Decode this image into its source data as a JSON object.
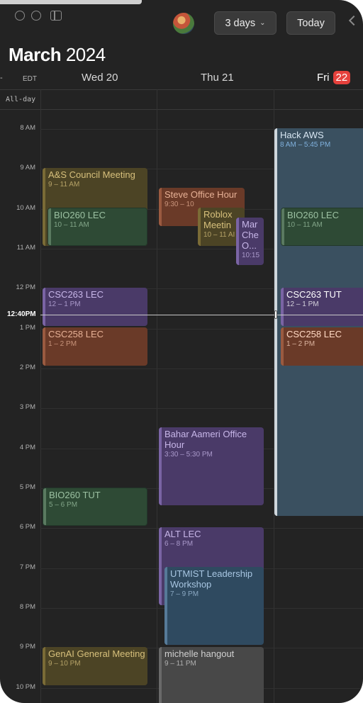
{
  "toolbar": {
    "view_label": "3 days",
    "today_label": "Today"
  },
  "header": {
    "month": "March",
    "year": "2024",
    "timezone": "EDT",
    "days": [
      {
        "label": "Wed 20"
      },
      {
        "label": "Thu 21"
      },
      {
        "label": "Fri",
        "date": "22",
        "is_today": true
      }
    ]
  },
  "all_day_label": "All-day",
  "hours": [
    "8 AM",
    "9 AM",
    "10 AM",
    "11 AM",
    "12 PM",
    "1 PM",
    "2 PM",
    "3 PM",
    "4 PM",
    "5 PM",
    "6 PM",
    "7 PM",
    "8 PM",
    "9 PM",
    "10 PM"
  ],
  "current_time": "12:40PM",
  "events": {
    "wed": [
      {
        "title": "A&S Council Meeting",
        "time": "9 – 11 AM",
        "color": "#4c4425"
      },
      {
        "title": "BIO260 LEC",
        "time": "10 – 11 AM",
        "color": "#2e4a35"
      },
      {
        "title": "CSC263 LEC",
        "time": "12 – 1 PM",
        "color": "#4a3a68"
      },
      {
        "title": "CSC258 LEC",
        "time": "1 – 2 PM",
        "color": "#6a3a28"
      },
      {
        "title": "BIO260 TUT",
        "time": "5 – 6 PM",
        "color": "#2e4a35"
      },
      {
        "title": "GenAI General Meeting",
        "time": "9 – 10 PM",
        "color": "#4c4425"
      }
    ],
    "thu": [
      {
        "title": "Steve Office Hour",
        "time": "9:30 – 10",
        "color": "#6a3a28"
      },
      {
        "title": "Roblox Meetin",
        "time": "10 – 11 AI",
        "color": "#4c4425"
      },
      {
        "title": "Mar Che O...",
        "time": "10:15",
        "color": "#4a3a68"
      },
      {
        "title": "Bahar Aameri Office Hour",
        "time": "3:30 – 5:30 PM",
        "color": "#4a3a68"
      },
      {
        "title": "ALT LEC",
        "time": "6 – 8 PM",
        "color": "#4a3a68"
      },
      {
        "title": "UTMIST Leadership Workshop",
        "time": "7 – 9 PM",
        "color": "#2f4a60"
      },
      {
        "title": "michelle hangout",
        "time": "9 – 11 PM",
        "color": "#484848"
      }
    ],
    "fri": [
      {
        "title": "Hack AWS",
        "time": "8 AM – 5:45 PM",
        "color": "#3a5060"
      },
      {
        "title": "BIO260 LEC",
        "time": "10 – 11 AM",
        "color": "#2e4a35"
      },
      {
        "title": "CSC263 TUT",
        "time": "12 – 1 PM",
        "color": "#4a3a68"
      },
      {
        "title": "CSC258 LEC",
        "time": "1 – 2 PM",
        "color": "#6a3a28"
      }
    ]
  }
}
